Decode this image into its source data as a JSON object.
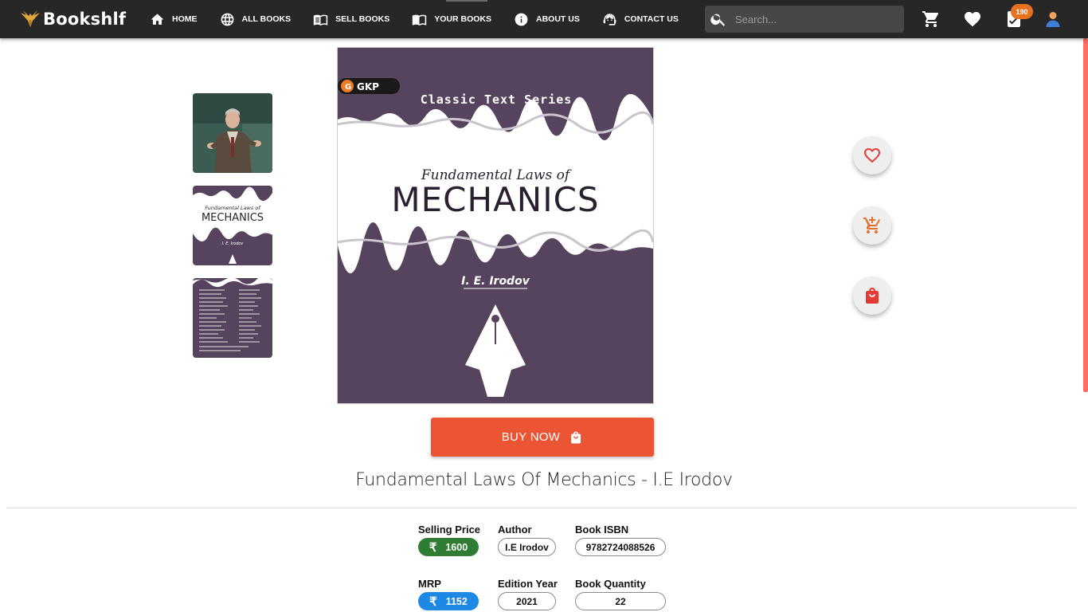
{
  "navbar": {
    "brand": "Bookshlf",
    "links": [
      {
        "label": "HOME",
        "icon": "home-icon"
      },
      {
        "label": "ALL BOOKS",
        "icon": "globe-icon"
      },
      {
        "label": "SELL BOOKS",
        "icon": "book-open-icon"
      },
      {
        "label": "YOUR BOOKS",
        "icon": "book-open-icon"
      },
      {
        "label": "ABOUT US",
        "icon": "info-icon"
      },
      {
        "label": "CONTACT US",
        "icon": "support-agent-icon"
      }
    ],
    "search_placeholder": "Search...",
    "cart_icon": "cart-icon",
    "wishlist_icon": "heart-icon",
    "orders_icon": "orders-icon",
    "orders_badge": "190",
    "profile_icon": "user-avatar-icon"
  },
  "cover": {
    "publisher": "GKP",
    "series": "Classic Text Series",
    "subtitle": "Fundamental Laws of",
    "main_title": "MECHANICS",
    "author": "I. E. Irodov"
  },
  "thumb_cover": {
    "subtitle": "Fundamental Laws of",
    "main_title": "MECHANICS",
    "author": "I. E. Irodov"
  },
  "actions": {
    "wishlist_icon": "heart-outline-icon",
    "add_to_cart_icon": "add-cart-icon",
    "buy_icon": "shopping-bag-icon",
    "buy_now_label": "BUY NOW"
  },
  "book": {
    "title": "Fundamental Laws Of Mechanics - I.E Irodov",
    "currency_symbol": "₹",
    "selling_price_label": "Selling Price",
    "selling_price": "1600",
    "author_label": "Author",
    "author": "I.E Irodov",
    "isbn_label": "Book ISBN",
    "isbn": "9782724088526",
    "mrp_label": "MRP",
    "mrp": "1152",
    "edition_label": "Edition Year",
    "edition": "2021",
    "quantity_label": "Book Quantity",
    "quantity": "22"
  },
  "colors": {
    "navbar": "#272727",
    "accent_orange": "#ec5533",
    "selling_price_pill": "#2e7d32",
    "mrp_pill": "#1e88e5",
    "cover_purple": "#56445e",
    "scrollbar": "#ff6b65",
    "badge": "#e8711d"
  }
}
